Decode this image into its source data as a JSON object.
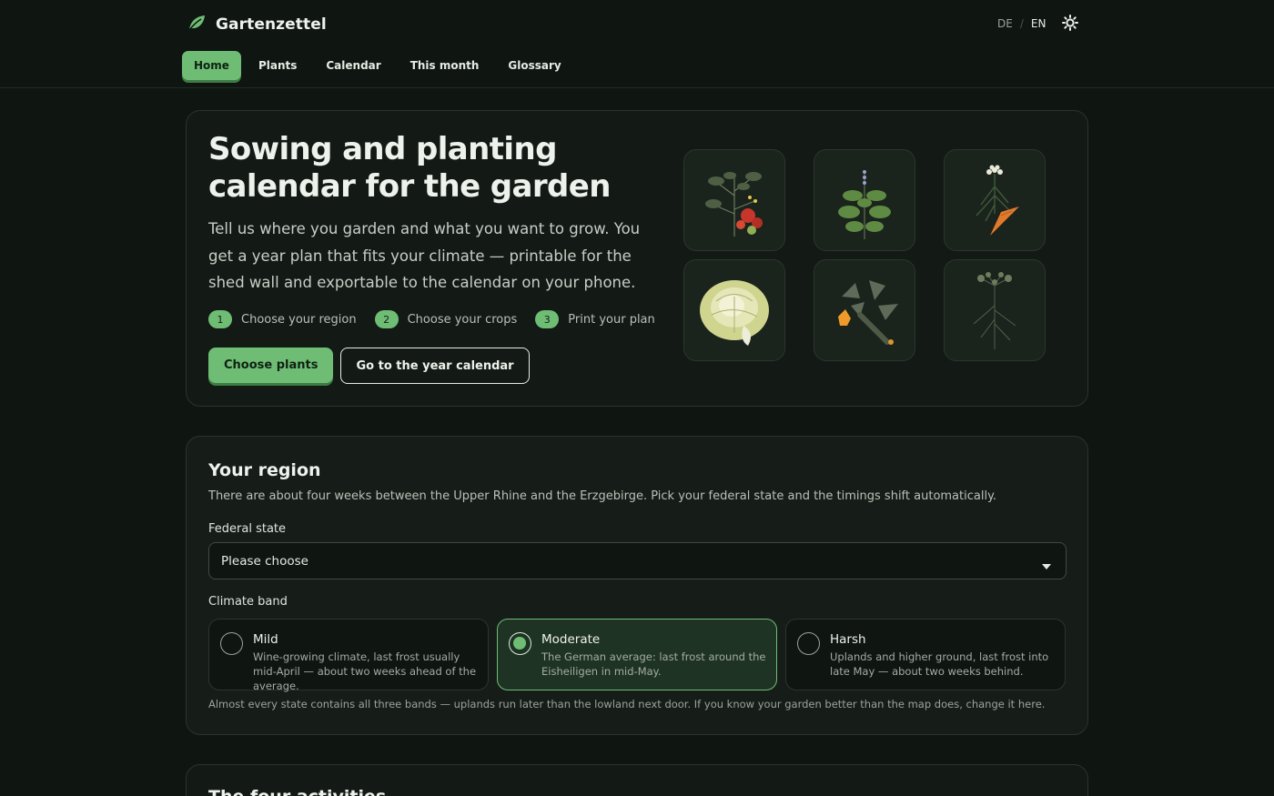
{
  "header": {
    "brand": "Gartenzettel",
    "lang": {
      "de": "DE",
      "sep": "/",
      "en": "EN",
      "active": "EN"
    },
    "theme_icon": "sun-icon"
  },
  "nav": {
    "items": [
      {
        "label": "Home",
        "active": true
      },
      {
        "label": "Plants"
      },
      {
        "label": "Calendar"
      },
      {
        "label": "This month"
      },
      {
        "label": "Glossary"
      }
    ]
  },
  "hero": {
    "title": "Sowing and planting calendar for the garden",
    "lead": "Tell us where you garden and what you want to grow. You get a year plan that fits your climate — printable for the shed wall and exportable to the calendar on your phone.",
    "steps": [
      {
        "num": "1",
        "label": "Choose your region"
      },
      {
        "num": "2",
        "label": "Choose your crops"
      },
      {
        "num": "3",
        "label": "Print your plan"
      }
    ],
    "primary_button": "Choose plants",
    "secondary_button": "Go to the year calendar",
    "tiles": [
      "tomato-illustration",
      "basil-illustration",
      "carrot-illustration",
      "lettuce-illustration",
      "zucchini-illustration",
      "dill-illustration"
    ]
  },
  "region": {
    "title": "Your region",
    "description": "There are about four weeks between the Upper Rhine and the Erzgebirge. Pick your federal state and the timings shift automatically.",
    "state_label": "Federal state",
    "state_value": "Please choose",
    "band_label": "Climate band",
    "bands": [
      {
        "title": "Mild",
        "desc": "Wine-growing climate, last frost usually mid-April — about two weeks ahead of the average."
      },
      {
        "title": "Moderate",
        "desc": "The German average: last frost around the Eisheiligen in mid-May.",
        "selected": true
      },
      {
        "title": "Harsh",
        "desc": "Uplands and higher ground, last frost into late May — about two weeks behind."
      }
    ],
    "note": "Almost every state contains all three bands — uplands run later than the lowland next door. If you know your garden better than the map does, change it here."
  },
  "next_section": {
    "title": "The four activities"
  },
  "colors": {
    "accent": "#6fbd75",
    "background": "#0f1511",
    "card": "#131a15"
  }
}
